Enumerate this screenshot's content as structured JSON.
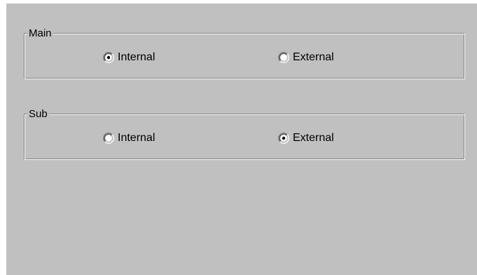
{
  "groups": [
    {
      "legend": "Main",
      "options": [
        {
          "label": "Internal",
          "checked": true
        },
        {
          "label": "External",
          "checked": false
        }
      ]
    },
    {
      "legend": "Sub",
      "options": [
        {
          "label": "Internal",
          "checked": false
        },
        {
          "label": "External",
          "checked": true
        }
      ]
    }
  ],
  "colors": {
    "panel_background": "#c0c0c0",
    "shadow": "#808080",
    "highlight": "#ffffff",
    "dark_shadow": "#404040",
    "text": "#000000"
  }
}
